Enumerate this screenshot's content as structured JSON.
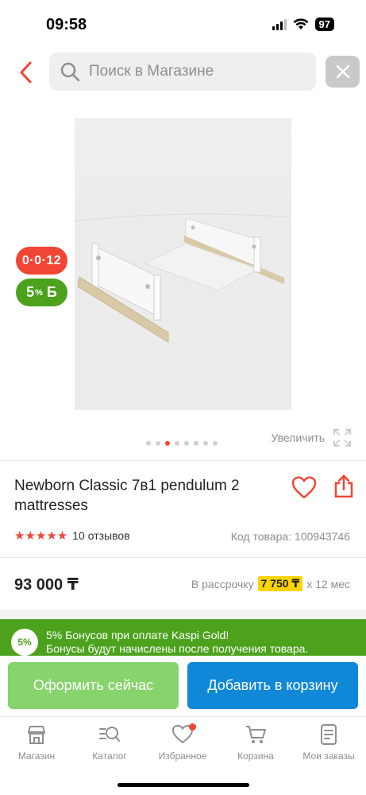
{
  "status_bar": {
    "time": "09:58",
    "battery": "97"
  },
  "search": {
    "placeholder": "Поиск в Магазине"
  },
  "badges": {
    "timer": "0·0·12",
    "bonus_value": "5",
    "bonus_unit": "%",
    "bonus_currency": "Б"
  },
  "gallery": {
    "zoom_label": "Увеличить",
    "total_images": 8,
    "active_index": 2
  },
  "product": {
    "title": "Newborn Classic 7в1 pendulum 2 mattresses",
    "stars": "★★★★★",
    "reviews": "10 отзывов",
    "sku_label": "Код товара:",
    "sku_value": "100943746",
    "price": "93 000 ₸",
    "installment_prefix": "В рассрочку",
    "installment_amount": "7 750 ₸",
    "installment_suffix": "x 12 мес"
  },
  "promo": {
    "circle": "5%",
    "line1": "5% Бонусов при оплате Kaspi Gold!",
    "line2": "Бонусы будут начислены после получения товара."
  },
  "actions": {
    "buy_now": "Оформить сейчас",
    "add_to_cart": "Добавить в корзину"
  },
  "tabs": [
    {
      "label": "Магазин",
      "icon": "shop-icon"
    },
    {
      "label": "Каталог",
      "icon": "catalog-icon"
    },
    {
      "label": "Избранное",
      "icon": "heart-icon"
    },
    {
      "label": "Корзина",
      "icon": "cart-icon"
    },
    {
      "label": "Мои заказы",
      "icon": "orders-icon"
    }
  ],
  "colors": {
    "accent": "#f14635",
    "green": "#4ca21d",
    "blue": "#0f88d8",
    "yellow": "#ffd400"
  }
}
